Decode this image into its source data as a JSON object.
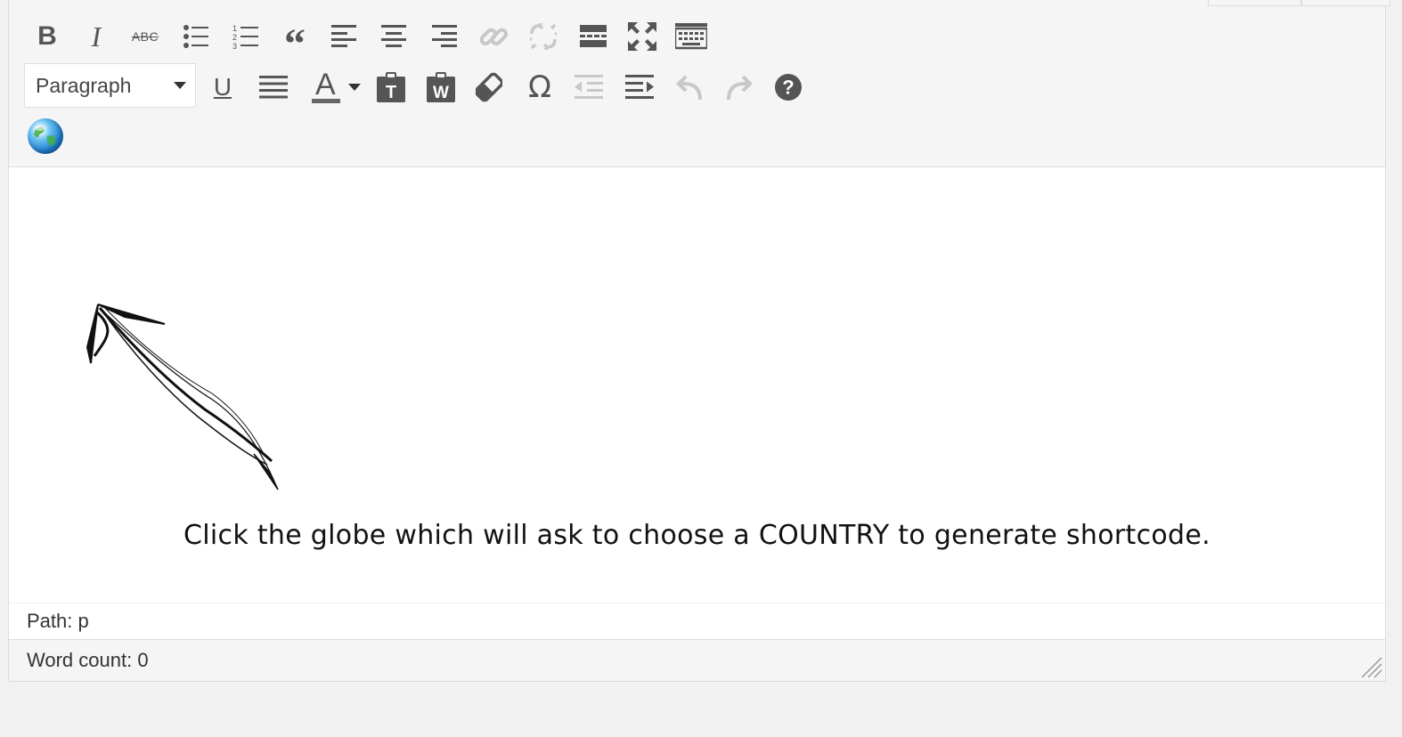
{
  "toolbar": {
    "row1": [
      {
        "name": "bold-button",
        "icon": "bold-icon",
        "label": "B"
      },
      {
        "name": "italic-button",
        "icon": "italic-icon",
        "label": "I"
      },
      {
        "name": "strikethrough-button",
        "icon": "strikethrough-icon",
        "label": "ABC"
      },
      {
        "name": "bullet-list-button",
        "icon": "bullet-list-icon"
      },
      {
        "name": "numbered-list-button",
        "icon": "numbered-list-icon",
        "label": "123"
      },
      {
        "name": "blockquote-button",
        "icon": "blockquote-icon"
      },
      {
        "name": "align-left-button",
        "icon": "align-left-icon"
      },
      {
        "name": "align-center-button",
        "icon": "align-center-icon"
      },
      {
        "name": "align-right-button",
        "icon": "align-right-icon"
      },
      {
        "name": "insert-link-button",
        "icon": "link-icon",
        "disabled": true
      },
      {
        "name": "remove-link-button",
        "icon": "unlink-icon",
        "disabled": true
      },
      {
        "name": "read-more-button",
        "icon": "read-more-icon"
      },
      {
        "name": "fullscreen-button",
        "icon": "fullscreen-icon"
      },
      {
        "name": "toolbar-toggle-button",
        "icon": "keyboard-icon"
      }
    ],
    "format_select": {
      "value": "Paragraph"
    },
    "row2": [
      {
        "name": "underline-button",
        "icon": "underline-icon",
        "label": "U"
      },
      {
        "name": "justify-button",
        "icon": "justify-icon"
      },
      {
        "name": "text-color-button",
        "icon": "text-color-icon",
        "label": "A"
      },
      {
        "name": "paste-text-button",
        "icon": "paste-text-icon",
        "label": "T"
      },
      {
        "name": "paste-word-button",
        "icon": "paste-word-icon",
        "label": "W"
      },
      {
        "name": "clear-formatting-button",
        "icon": "eraser-icon"
      },
      {
        "name": "special-character-button",
        "icon": "omega-icon",
        "label": "Ω"
      },
      {
        "name": "outdent-button",
        "icon": "outdent-icon",
        "disabled": true
      },
      {
        "name": "indent-button",
        "icon": "indent-icon"
      },
      {
        "name": "undo-button",
        "icon": "undo-icon",
        "disabled": true
      },
      {
        "name": "redo-button",
        "icon": "redo-icon",
        "disabled": true
      },
      {
        "name": "help-button",
        "icon": "help-icon",
        "label": "?"
      }
    ],
    "row3": [
      {
        "name": "country-shortcode-button",
        "icon": "globe-icon"
      }
    ]
  },
  "content": {
    "message": "Click the globe which will ask to choose a COUNTRY to generate shortcode."
  },
  "path_bar": {
    "text": "Path: p"
  },
  "status_bar": {
    "word_count": "Word count: 0"
  },
  "colors": {
    "icon": "#555555",
    "icon_disabled": "#c8c8c8",
    "toolbar_bg": "#f5f5f5",
    "page_bg": "#f1f1f1"
  }
}
